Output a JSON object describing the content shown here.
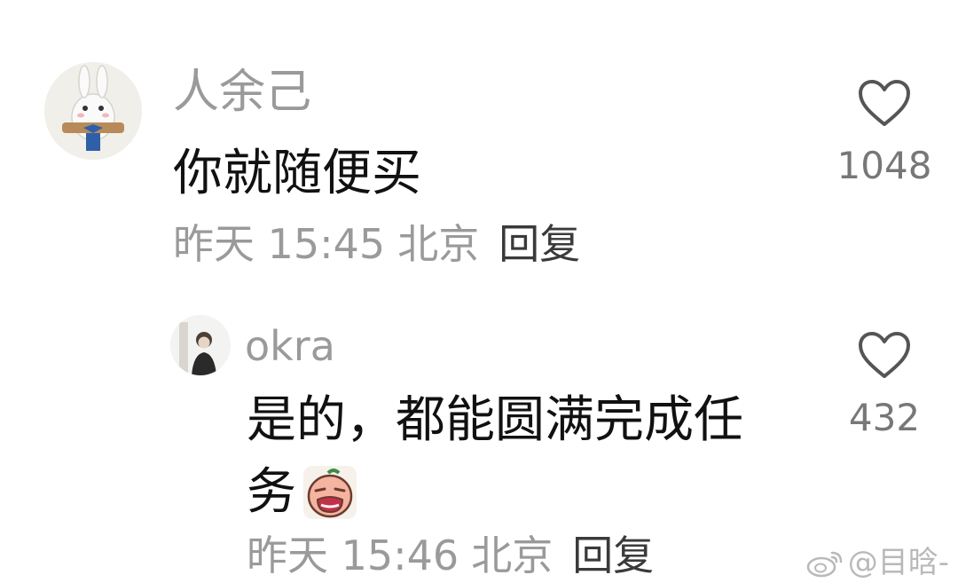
{
  "comments": [
    {
      "username": "人余己",
      "text": "你就随便买",
      "time": "昨天 15:45",
      "location": "北京",
      "reply_label": "回复",
      "like_count": "1048"
    },
    {
      "username": "okra",
      "text_line1": "是的，都能圆满完成任",
      "text_line2": "务",
      "time": "昨天 15:46",
      "location": "北京",
      "reply_label": "回复",
      "like_count": "432"
    }
  ],
  "watermark": {
    "text": "@目晗-"
  },
  "icons": {
    "like": "heart-outline-icon",
    "emoji": "crying-face-emoji-icon",
    "watermark": "weibo-icon"
  },
  "colors": {
    "username": "#9a9a9a",
    "meta": "#9a9a9a",
    "reply": "#3a3a3a",
    "text": "#111111",
    "like_count": "#777777"
  }
}
